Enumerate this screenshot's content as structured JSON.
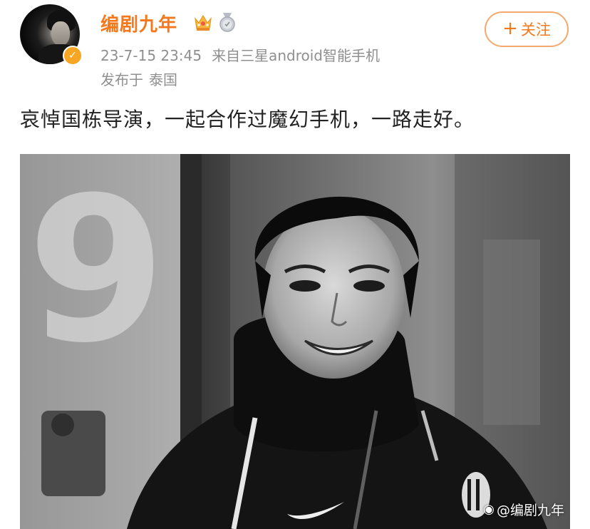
{
  "post": {
    "author": {
      "name": "编剧九年",
      "avatar_icon": "user-avatar",
      "verified_icon": "verified-badge-icon",
      "badges": [
        "crown-badge-icon",
        "medal-badge-icon"
      ]
    },
    "timestamp": "23-7-15 23:45",
    "source": "来自三星android智能手机",
    "location_label": "发布于",
    "location_value": "泰国",
    "follow_button": {
      "plus": "+",
      "label": "关注"
    },
    "text": "哀悼国栋导演，一起合作过魔幻手机，一路走好。",
    "image": {
      "jersey_number": "9",
      "watermark": "@编剧九年",
      "watermark_icon": "weibo-icon"
    }
  },
  "colors": {
    "username": "#f3791c",
    "meta": "#8f8f8f",
    "follow_border": "#f3a86e",
    "verified": "#f6a623",
    "text": "#222222"
  }
}
